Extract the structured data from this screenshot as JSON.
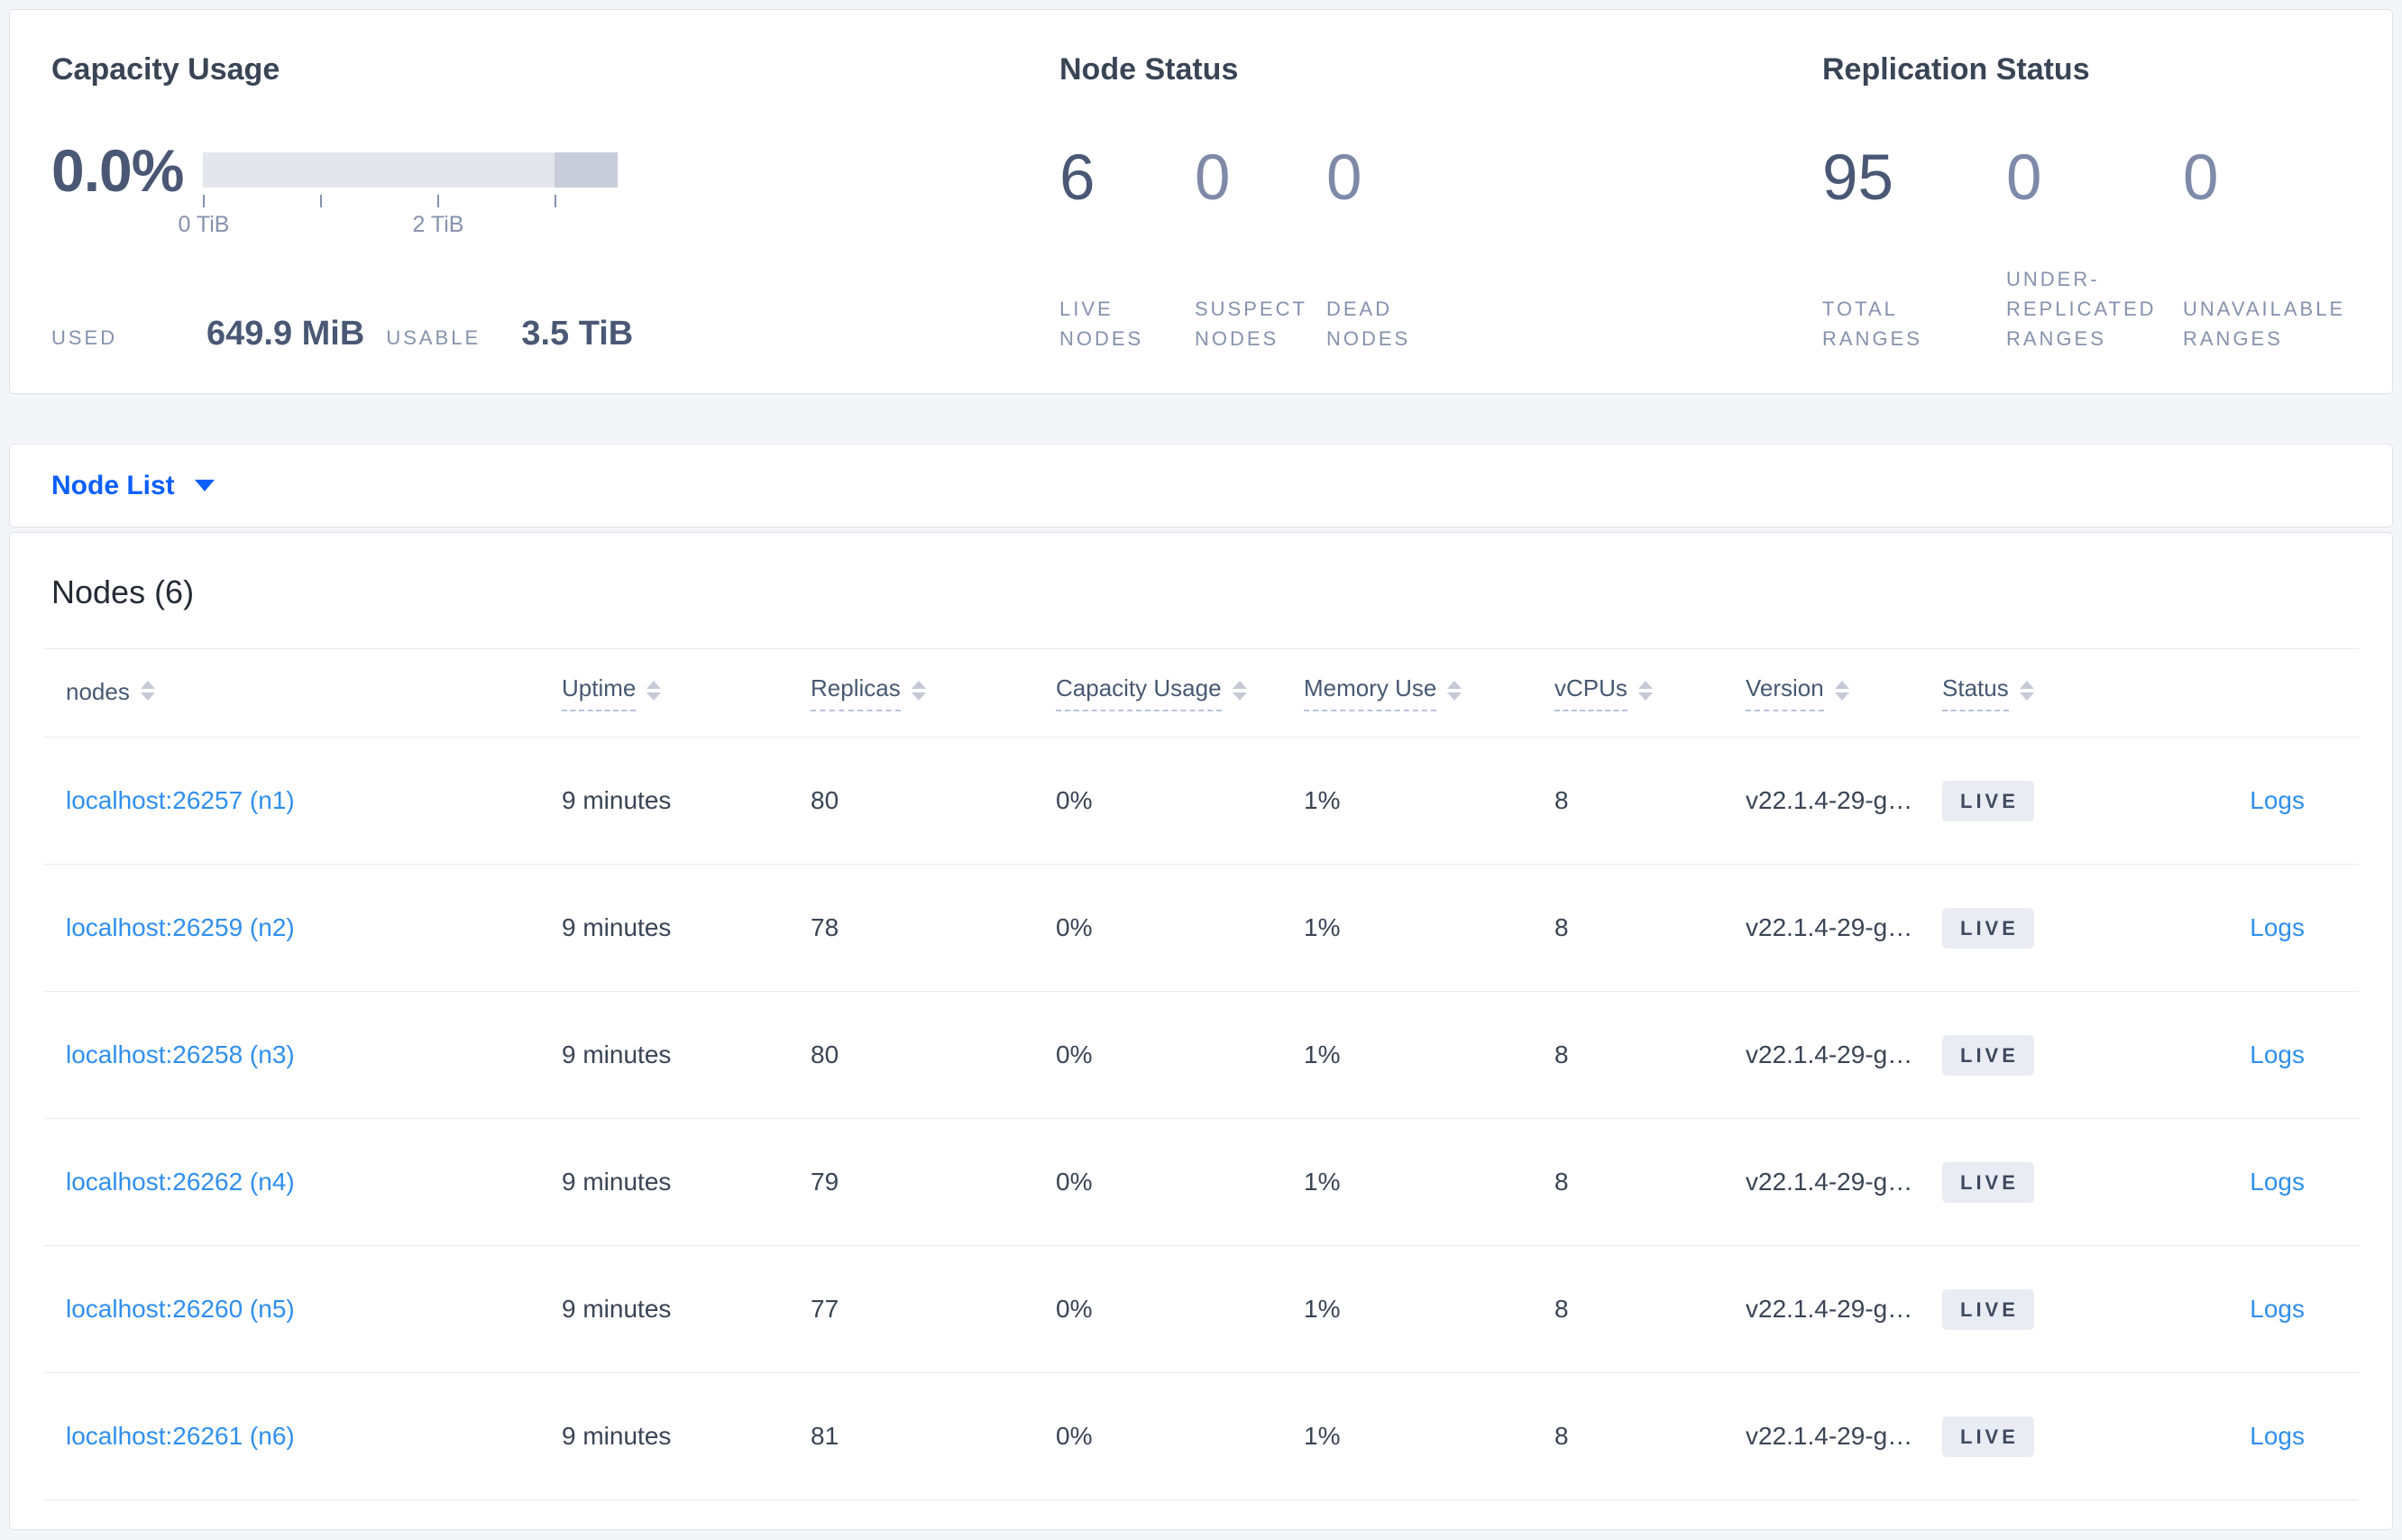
{
  "summary": {
    "capacity": {
      "title": "Capacity Usage",
      "percent": "0.0%",
      "tick_labels": [
        "0 TiB",
        "2 TiB"
      ],
      "used_label": "USED",
      "used_value": "649.9 MiB",
      "usable_label": "USABLE",
      "usable_value": "3.5 TiB"
    },
    "node_status": {
      "title": "Node Status",
      "stats": [
        {
          "value": "6",
          "label": "LIVE\nNODES"
        },
        {
          "value": "0",
          "label": "SUSPECT\nNODES"
        },
        {
          "value": "0",
          "label": "DEAD\nNODES"
        }
      ]
    },
    "replication": {
      "title": "Replication Status",
      "stats": [
        {
          "value": "95",
          "label": "TOTAL\nRANGES"
        },
        {
          "value": "0",
          "label": "UNDER-\nREPLICATED\nRANGES"
        },
        {
          "value": "0",
          "label": "UNAVAILABLE\nRANGES"
        }
      ]
    }
  },
  "nav": {
    "dropdown_label": "Node List"
  },
  "table": {
    "heading": "Nodes (6)",
    "columns": [
      {
        "label": "nodes"
      },
      {
        "label": "Uptime"
      },
      {
        "label": "Replicas"
      },
      {
        "label": "Capacity Usage"
      },
      {
        "label": "Memory Use"
      },
      {
        "label": "vCPUs"
      },
      {
        "label": "Version"
      },
      {
        "label": "Status"
      },
      {
        "label": ""
      }
    ],
    "rows": [
      {
        "node": "localhost:26257 (n1)",
        "uptime": "9 minutes",
        "replicas": "80",
        "capacity": "0%",
        "memory": "1%",
        "vcpus": "8",
        "version": "v22.1.4-29-g…",
        "status": "LIVE",
        "logs": "Logs"
      },
      {
        "node": "localhost:26259 (n2)",
        "uptime": "9 minutes",
        "replicas": "78",
        "capacity": "0%",
        "memory": "1%",
        "vcpus": "8",
        "version": "v22.1.4-29-g…",
        "status": "LIVE",
        "logs": "Logs"
      },
      {
        "node": "localhost:26258 (n3)",
        "uptime": "9 minutes",
        "replicas": "80",
        "capacity": "0%",
        "memory": "1%",
        "vcpus": "8",
        "version": "v22.1.4-29-g…",
        "status": "LIVE",
        "logs": "Logs"
      },
      {
        "node": "localhost:26262 (n4)",
        "uptime": "9 minutes",
        "replicas": "79",
        "capacity": "0%",
        "memory": "1%",
        "vcpus": "8",
        "version": "v22.1.4-29-g…",
        "status": "LIVE",
        "logs": "Logs"
      },
      {
        "node": "localhost:26260 (n5)",
        "uptime": "9 minutes",
        "replicas": "77",
        "capacity": "0%",
        "memory": "1%",
        "vcpus": "8",
        "version": "v22.1.4-29-g…",
        "status": "LIVE",
        "logs": "Logs"
      },
      {
        "node": "localhost:26261 (n6)",
        "uptime": "9 minutes",
        "replicas": "81",
        "capacity": "0%",
        "memory": "1%",
        "vcpus": "8",
        "version": "v22.1.4-29-g…",
        "status": "LIVE",
        "logs": "Logs"
      }
    ]
  },
  "colors": {
    "link-blue": "#2f8fef",
    "nav-blue": "#0b5fff",
    "title-dark": "#394455",
    "num-dark": "#4a5875",
    "muted": "#8592ad",
    "badge-bg": "#e9ecf2",
    "gauge-light": "#e4e6ed",
    "gauge-dark": "#c9cdd9",
    "page-bg": "#f3f5f9"
  }
}
